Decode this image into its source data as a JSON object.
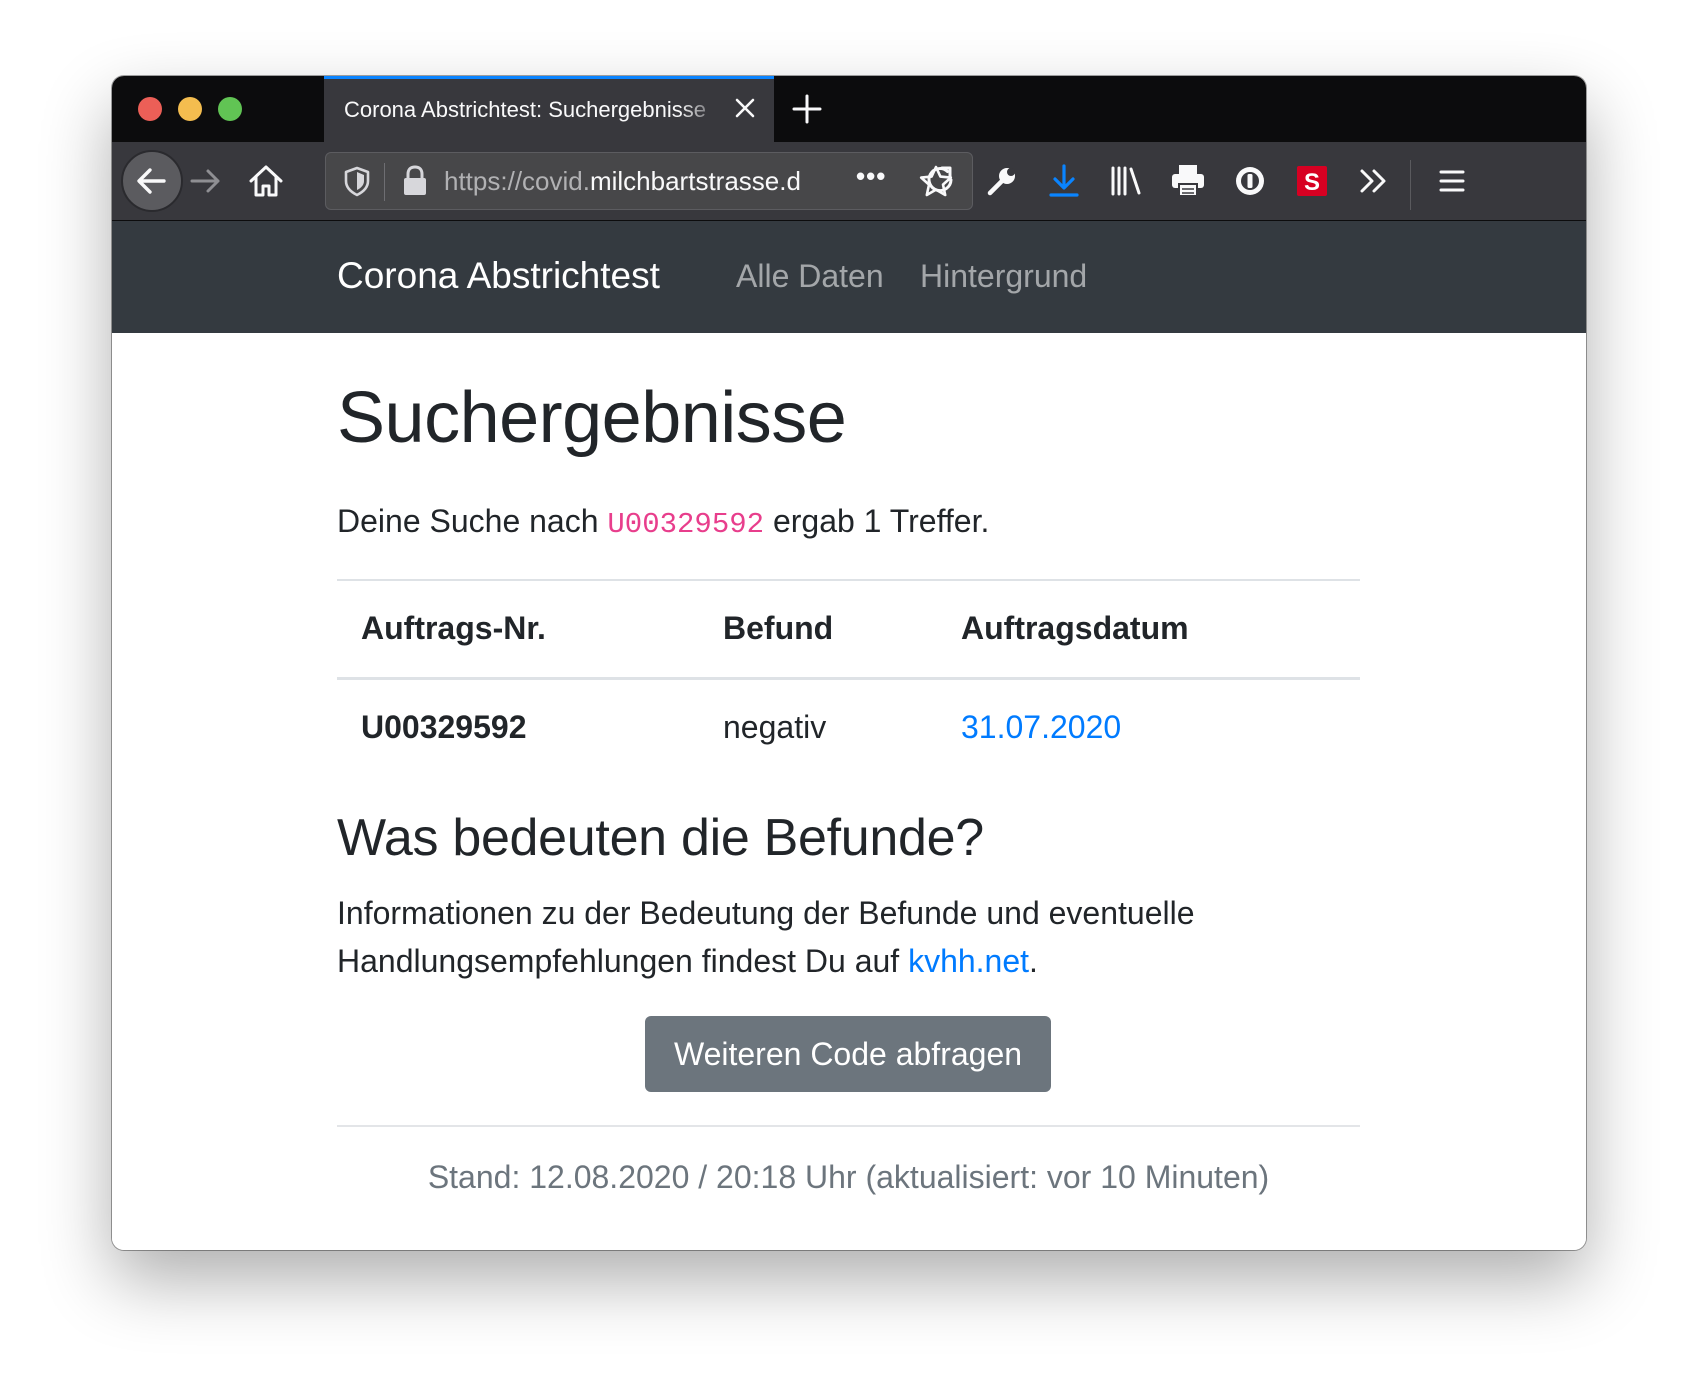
{
  "browser": {
    "tab_title": "Corona Abstrichtest: Suchergebnisse",
    "url_prefix": "https://covid.",
    "url_host": "milchbartstrasse.d",
    "url_more": "•••"
  },
  "site": {
    "brand": "Corona Abstrichtest",
    "nav": [
      "Alle Daten",
      "Hintergrund"
    ]
  },
  "main": {
    "title": "Suchergebnisse",
    "lead_before": "Deine Suche nach ",
    "lead_code": "U00329592",
    "lead_after": " ergab 1 Treffer.",
    "table": {
      "headers": [
        "Auftrags-Nr.",
        "Befund",
        "Auftragsdatum"
      ],
      "rows": [
        [
          "U00329592",
          "negativ",
          "31.07.2020"
        ]
      ]
    },
    "subtitle": "Was bedeuten die Befunde?",
    "info_before": "Informationen zu der Bedeutung der Befunde und eventuelle Handlungsempfehlungen findest Du auf ",
    "info_link": "kvhh.net",
    "info_after": ".",
    "button": "Weiteren Code abfragen",
    "footer": "Stand: 12.08.2020 / 20:18 Uhr (aktualisiert: vor 10 Minuten)"
  },
  "colors": {
    "accent": "#0a84ff",
    "link": "#007bff",
    "code": "#e83e8c",
    "navbar": "#343a40",
    "button": "#6c757d"
  },
  "icons": [
    "back-icon",
    "forward-icon",
    "home-icon",
    "shield-icon",
    "lock-icon",
    "star-icon",
    "reload-icon",
    "wrench-icon",
    "download-icon",
    "library-icon",
    "print-icon",
    "extension-icon",
    "s-extension-icon",
    "overflow-icon",
    "menu-icon"
  ]
}
